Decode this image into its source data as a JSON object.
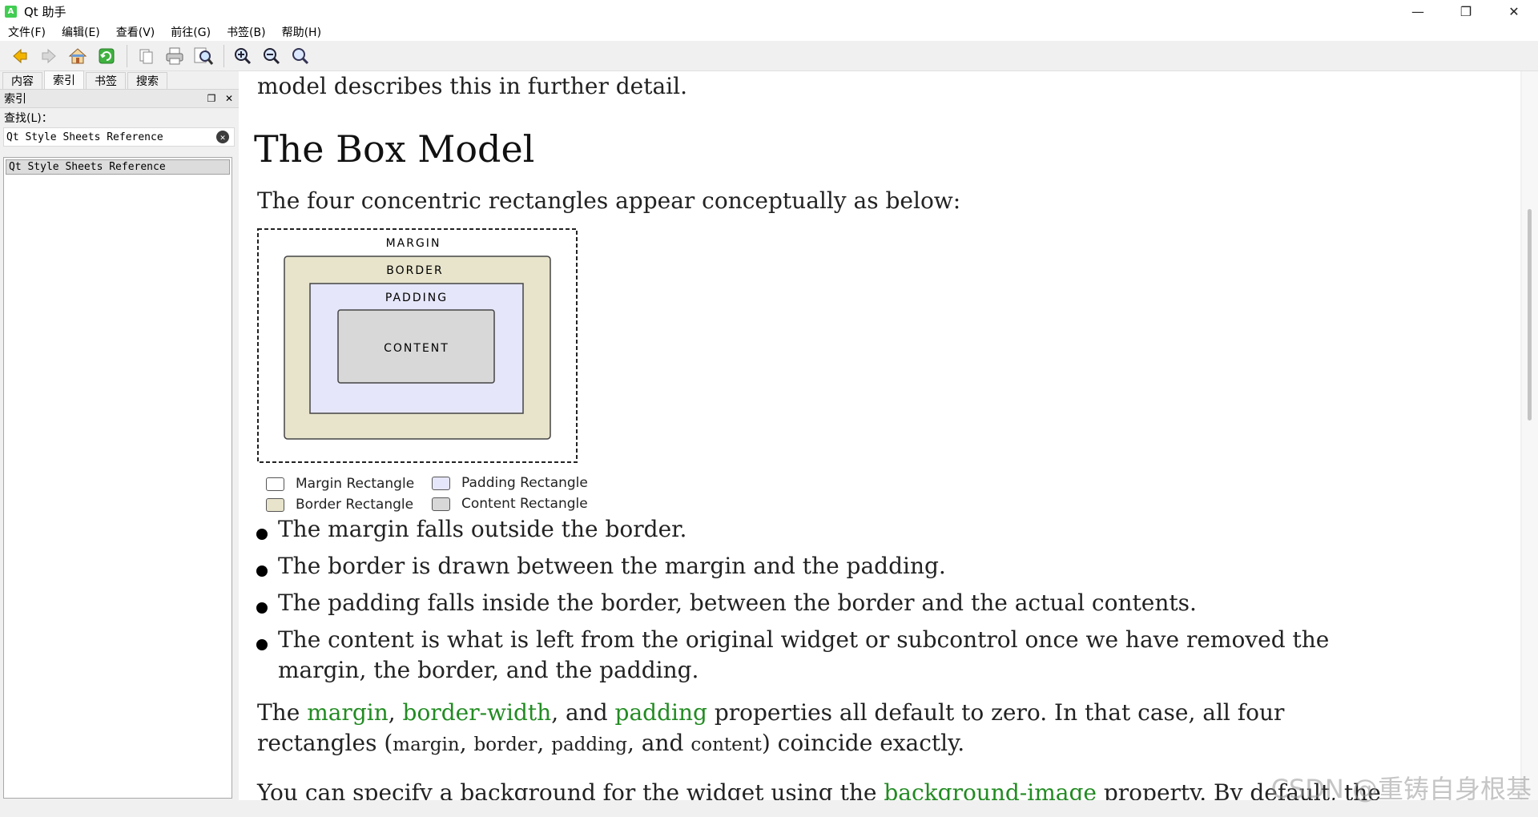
{
  "window": {
    "title": "Qt 助手",
    "app_icon": "A",
    "controls": [
      "—",
      "❐",
      "✕"
    ]
  },
  "menu": [
    "文件(F)",
    "编辑(E)",
    "查看(V)",
    "前往(G)",
    "书签(B)",
    "帮助(H)"
  ],
  "toolbar": {
    "icons": [
      "back-arrow-icon",
      "forward-arrow-icon",
      "home-icon",
      "sync-icon",
      "copy-icon",
      "print-icon",
      "find-icon",
      "zoom-in-icon",
      "zoom-out-icon",
      "zoom-reset-icon"
    ]
  },
  "sidebar": {
    "tabs": [
      "内容",
      "索引",
      "书签",
      "搜索"
    ],
    "active_tab": "索引",
    "dock_title": "索引",
    "find_label": "查找(L)：",
    "search_value": "Qt Style Sheets Reference",
    "results": [
      "Qt Style Sheets Reference"
    ]
  },
  "content": {
    "prev_line": "model describes this in further detail.",
    "heading": "The Box Model",
    "intro": "The four concentric rectangles appear conceptually as below:",
    "diagram": {
      "margin": "MARGIN",
      "border": "BORDER",
      "padding": "PADDING",
      "content": "CONTENT"
    },
    "legend": [
      {
        "label": "Margin Rectangle",
        "color": "#ffffff"
      },
      {
        "label": "Padding Rectangle",
        "color": "#e6e6fa"
      },
      {
        "label": "Border Rectangle",
        "color": "#e8e4cc"
      },
      {
        "label": "Content Rectangle",
        "color": "#d8d8d8"
      }
    ],
    "bullets": [
      "The margin falls outside the border.",
      "The border is drawn between the margin and the padding.",
      "The padding falls inside the border, between the border and the actual contents.",
      "The content is what is left from the original widget or subcontrol once we have removed the",
      "margin, the border, and the padding."
    ],
    "para1": {
      "t1": "The ",
      "link1": "margin",
      "t2": ", ",
      "link2": "border-width",
      "t3": ", and ",
      "link3": "padding",
      "t4": " properties all default to zero. In that case, all four",
      "l2a": "rectangles (",
      "c1": "margin",
      "l2b": ", ",
      "c2": "border",
      "l2c": ", ",
      "c3": "padding",
      "l2d": ", and ",
      "c4": "content",
      "l2e": ") coincide exactly."
    },
    "para2": {
      "t1": "You can specify a background for the widget using the ",
      "link1": "background-image",
      "t2": " property. By default, the"
    }
  },
  "watermark": "CSDN @重铸自身根基",
  "colors": {
    "link": "#228B22",
    "margin_fill": "#ffffff",
    "border_fill": "#e8e4cc",
    "padding_fill": "#e6e6fa",
    "content_fill": "#d8d8d8"
  }
}
